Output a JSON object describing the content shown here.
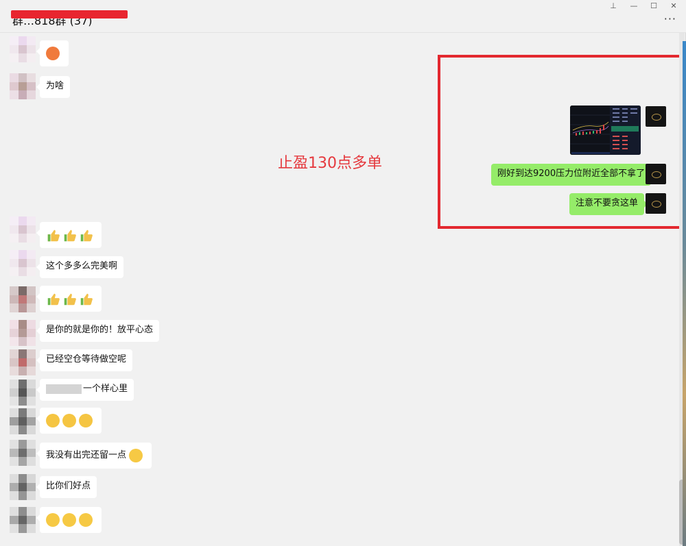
{
  "window": {
    "title": "群…818群 (37)",
    "controls": [
      "pin-icon",
      "minimize-icon",
      "maximize-icon",
      "close-icon"
    ],
    "more_label": "···"
  },
  "annotation": {
    "center_note": "止盈130点多单",
    "highlight_color": "#e3282f"
  },
  "messages": [
    {
      "side": "left",
      "type": "emoji",
      "emoji": "angry-face"
    },
    {
      "side": "left",
      "type": "text",
      "text": "为啥"
    },
    {
      "side": "right",
      "type": "image",
      "image": "candlestick-chart-screenshot"
    },
    {
      "side": "right",
      "type": "text",
      "text": "刚好到达9200压力位附近全部不拿了"
    },
    {
      "side": "right",
      "type": "text",
      "text": "注意不要贪这单"
    },
    {
      "side": "left",
      "type": "emoji",
      "emoji": "thumbs-up x3"
    },
    {
      "side": "left",
      "type": "text",
      "text": "这个多多么完美啊"
    },
    {
      "side": "left",
      "type": "emoji",
      "emoji": "thumbs-up x3"
    },
    {
      "side": "left",
      "type": "text",
      "text": "是你的就是你的！放平心态"
    },
    {
      "side": "left",
      "type": "text",
      "text": "已经空仓等待做空呢"
    },
    {
      "side": "left",
      "type": "text",
      "text": "一个样心里"
    },
    {
      "side": "left",
      "type": "emoji",
      "emoji": "laughing-tears x3"
    },
    {
      "side": "left",
      "type": "text",
      "text": "我没有出完还留一点"
    },
    {
      "side": "left",
      "type": "text",
      "text": "比你们好点"
    },
    {
      "side": "left",
      "type": "emoji",
      "emoji": "grin x3"
    }
  ],
  "colors": {
    "background": "#f1f1f1",
    "bubble_left": "#ffffff",
    "bubble_right": "#95ec69",
    "annotation_red": "#e5393e"
  }
}
